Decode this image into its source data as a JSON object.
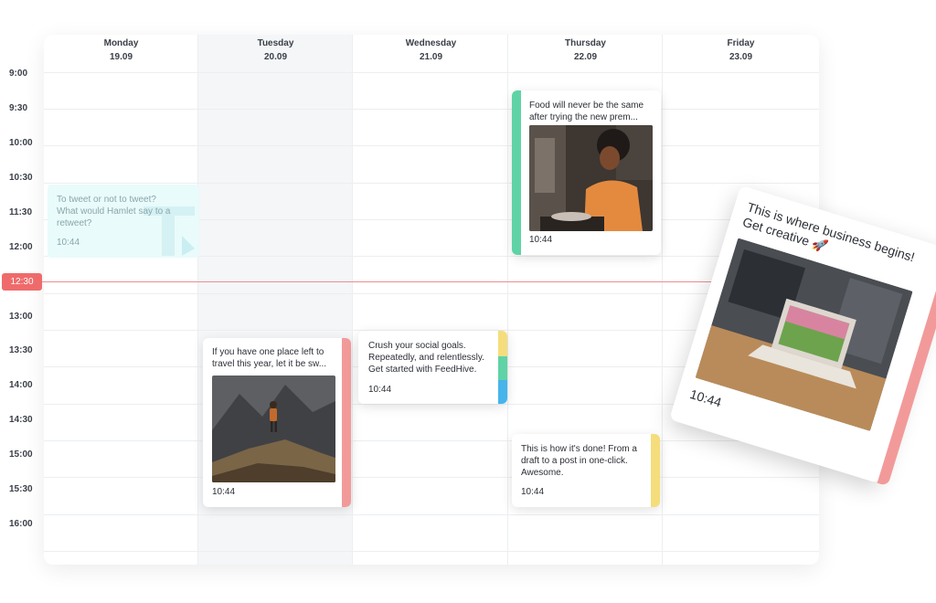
{
  "days": [
    {
      "name": "Monday",
      "date": "19.09"
    },
    {
      "name": "Tuesday",
      "date": "20.09"
    },
    {
      "name": "Wednesday",
      "date": "21.09"
    },
    {
      "name": "Thursday",
      "date": "22.09"
    },
    {
      "name": "Friday",
      "date": "23.09"
    }
  ],
  "times": [
    "9:00",
    "9:30",
    "10:00",
    "10:30",
    "11:30",
    "12:00",
    "13:00",
    "13:30",
    "14:00",
    "14:30",
    "15:00",
    "15:30",
    "16:00"
  ],
  "current_time": "12:30",
  "colors": {
    "accent_red": "#ef6b6b",
    "green": "#5fd3a6",
    "yellow": "#f5dd7c",
    "blue": "#47b4ec",
    "pink": "#f29a9a"
  },
  "posts": {
    "monday_draft": {
      "text": "To tweet or not to tweet? What would Hamlet say to a retweet?",
      "time": "10:44"
    },
    "thursday_food": {
      "text": "Food will never be the same after trying the new prem...",
      "time": "10:44",
      "image": "woman-in-kitchen-photo"
    },
    "tuesday_travel": {
      "text": "If you have one place left to travel this year, let it be sw...",
      "time": "10:44",
      "image": "hiker-on-mountain-photo"
    },
    "wednesday_social": {
      "text": "Crush your social goals. Repeatedly, and relentlessly. Get started with FeedHive.",
      "time": "10:44"
    },
    "thursday_draft": {
      "text": "This is how it's done! From a draft to a post in one-click. Awesome.",
      "time": "10:44"
    },
    "floating_card": {
      "text": "This is where business begins! Get creative 🚀",
      "time": "10:44",
      "image": "laptop-on-desk-photo"
    }
  }
}
